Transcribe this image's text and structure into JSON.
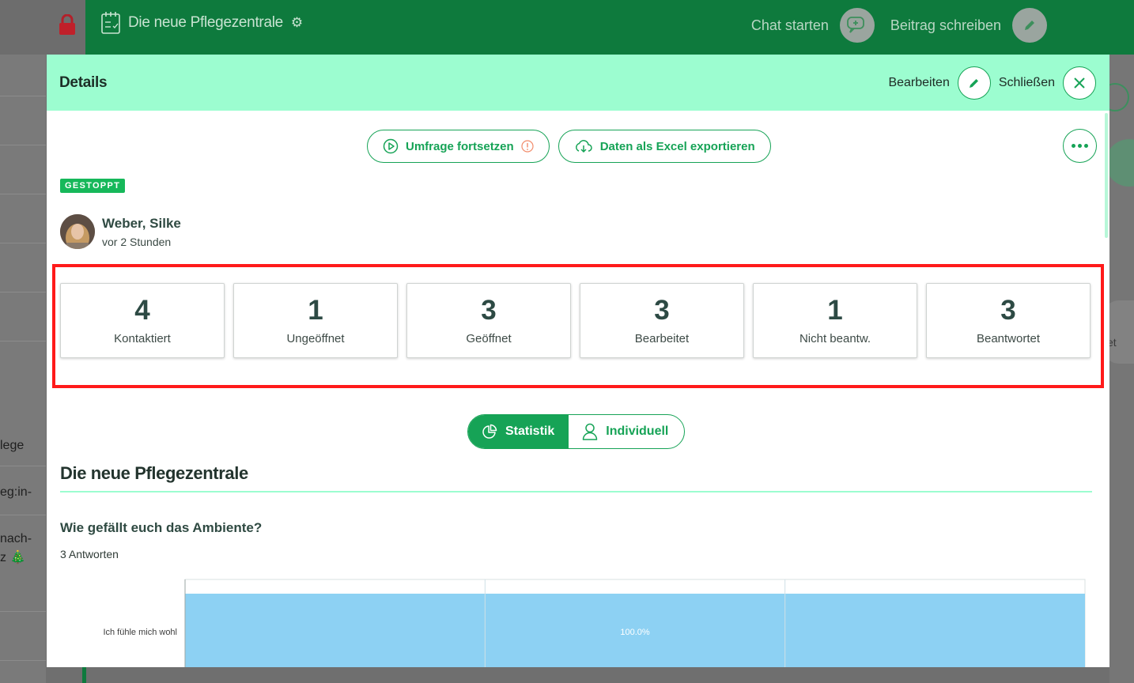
{
  "background": {
    "app_title": "Die neue Pflegezentrale",
    "top_actions": {
      "chat": "Chat starten",
      "post": "Beitrag schreiben"
    },
    "sidebar_fragments": [
      "lege",
      "eg:in-",
      "nach-",
      "z 🎄"
    ],
    "right_fragment": "et"
  },
  "modal": {
    "title": "Details",
    "edit_label": "Bearbeiten",
    "close_label": "Schließen",
    "actions": {
      "resume_survey": "Umfrage fortsetzen",
      "export_excel": "Daten als Excel exportieren"
    },
    "status": "GESTOPPT",
    "author": {
      "name": "Weber, Silke",
      "time": "vor 2 Stunden"
    },
    "stats": [
      {
        "value": "4",
        "label": "Kontaktiert"
      },
      {
        "value": "1",
        "label": "Ungeöffnet"
      },
      {
        "value": "3",
        "label": "Geöffnet"
      },
      {
        "value": "3",
        "label": "Bearbeitet"
      },
      {
        "value": "1",
        "label": "Nicht beantw."
      },
      {
        "value": "3",
        "label": "Beantwortet"
      }
    ],
    "view_toggle": {
      "statistics": "Statistik",
      "individual": "Individuell",
      "active": "Statistik"
    },
    "section_title": "Die neue Pflegezentrale",
    "question": "Wie gefällt euch das Ambiente?",
    "answers_count": "3 Antworten"
  },
  "colors": {
    "brand_green": "#16a356",
    "header_mint": "#9cfdd0",
    "bar_blue": "#8dd1f3",
    "highlight_red": "#ff1a1a"
  },
  "chart_data": {
    "type": "bar",
    "orientation": "horizontal",
    "categories": [
      "Ich fühle mich wohl"
    ],
    "values": [
      100.0
    ],
    "data_labels": [
      "100.0%"
    ],
    "xlim": [
      0,
      100
    ],
    "grid": true
  }
}
